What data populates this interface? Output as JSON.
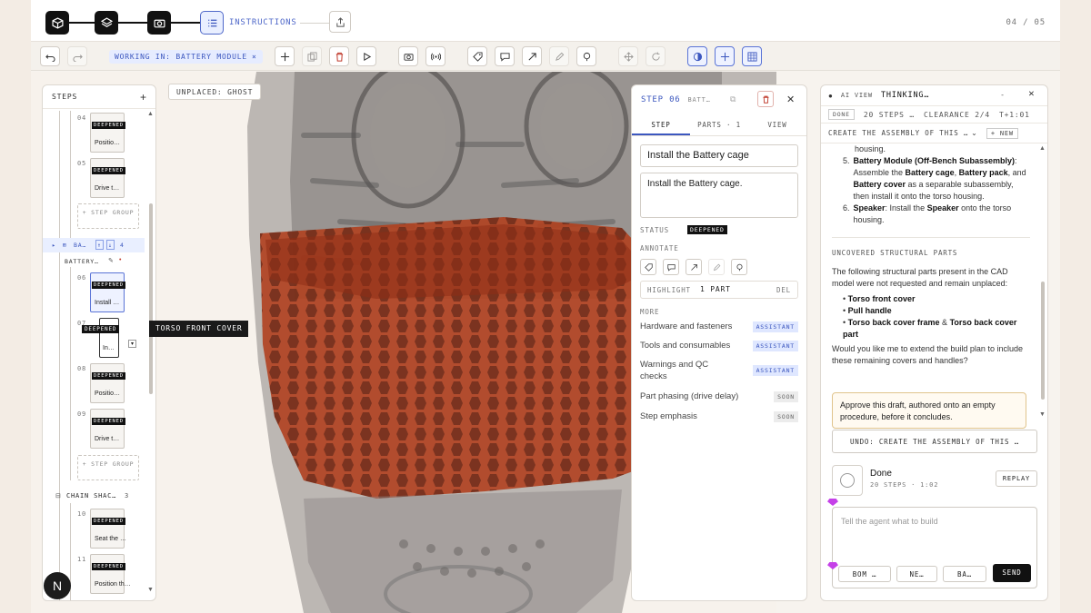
{
  "topbar": {
    "stage_label": "INSTRUCTIONS",
    "page_indicator": "04 / 05"
  },
  "toolbar": {
    "working_in": "WORKING IN: BATTERY MODULE",
    "working_close": "×"
  },
  "viewport": {
    "unplaced_label": "UNPLACED: GHOST"
  },
  "steps_panel": {
    "title": "STEPS",
    "add": "+",
    "add_group_label": "+ STEP GROUP",
    "group_battery": {
      "short": "BA…",
      "count": "4",
      "sub": "BATTERY…"
    },
    "group_chain": {
      "label": "CHAIN SHAC…",
      "count": "3"
    },
    "badge": "DEEPENED",
    "items": [
      {
        "num": "04",
        "label": "Positio…"
      },
      {
        "num": "05",
        "label": "Drive t…"
      },
      {
        "num": "06",
        "label": "Install …"
      },
      {
        "num": "07",
        "label": "In…"
      },
      {
        "num": "08",
        "label": "Positio…"
      },
      {
        "num": "09",
        "label": "Drive t…"
      },
      {
        "num": "10",
        "label": "Seat the …"
      },
      {
        "num": "11",
        "label": "Position th…"
      }
    ],
    "tooltip": "TORSO FRONT COVER",
    "logo": "N"
  },
  "detail": {
    "step_label": "STEP 06",
    "crumb": "BATT…",
    "tabs": [
      "STEP",
      "PARTS · 1",
      "VIEW"
    ],
    "title_value": "Install the Battery cage",
    "description": "Install the Battery cage.",
    "status_label": "STATUS",
    "status_value": "DEEPENED",
    "annotate_label": "ANNOTATE",
    "highlight_label": "HIGHLIGHT",
    "highlight_value": "1 PART",
    "highlight_del": "DEL",
    "more_label": "MORE",
    "more_items": [
      {
        "label": "Hardware and fasteners",
        "tag": "ASSISTANT",
        "kind": "assistant"
      },
      {
        "label": "Tools and consumables",
        "tag": "ASSISTANT",
        "kind": "assistant"
      },
      {
        "label": "Warnings and QC checks",
        "tag": "ASSISTANT",
        "kind": "assistant"
      },
      {
        "label": "Part phasing (drive delay)",
        "tag": "SOON",
        "kind": "soon"
      },
      {
        "label": "Step emphasis",
        "tag": "SOON",
        "kind": "soon"
      }
    ]
  },
  "thinking": {
    "ai_view": "AI VIEW",
    "title": "THINKING…",
    "min": "-",
    "done_chip": "DONE",
    "steps_count": "20 STEPS …",
    "clearance": "CLEARANCE 2/4",
    "timer": "T+1:01",
    "task": "CREATE THE ASSEMBLY OF THIS …",
    "new_btn": "+ NEW",
    "housing_tail": "housing.",
    "item5_num": "5.",
    "item5_bold": "Battery Module (Off-Bench Subassembly)",
    "item5_a": ": Assemble the ",
    "item5_b1": "Battery cage",
    "item5_c": ", ",
    "item5_b2": "Battery pack",
    "item5_d": ", and ",
    "item5_b3": "Battery cover",
    "item5_e": " as a separable subassembly, then install it onto the torso housing.",
    "item6_num": "6.",
    "item6_bold": "Speaker",
    "item6_a": ": Install the ",
    "item6_b": "Speaker",
    "item6_c": " onto the torso housing.",
    "uncovered_heading": "UNCOVERED STRUCTURAL PARTS",
    "uncovered_text": "The following structural parts present in the CAD model were not requested and remain unplaced:",
    "bullet1": "Torso front cover",
    "bullet2": "Pull handle",
    "bullet3a": "Torso back cover frame",
    "bullet3b": " & ",
    "bullet3c": "Torso back cover part",
    "question": "Would you like me to extend the build plan to include these remaining covers and handles?",
    "approve_text": "Approve this draft, authored onto an empty procedure, before it concludes.",
    "undo_btn": "UNDO: CREATE THE ASSEMBLY OF THIS …",
    "done_title": "Done",
    "done_sub": "20 STEPS · 1:02",
    "replay": "REPLAY",
    "prompt_placeholder": "Tell the agent what to build",
    "chip1": "BOM …",
    "chip2": "NE…",
    "chip3": "BA…",
    "send": "SEND"
  },
  "colors": {
    "accent": "#3c57bf",
    "part_highlight": "#b8401f",
    "ghost": "#7d7875"
  }
}
